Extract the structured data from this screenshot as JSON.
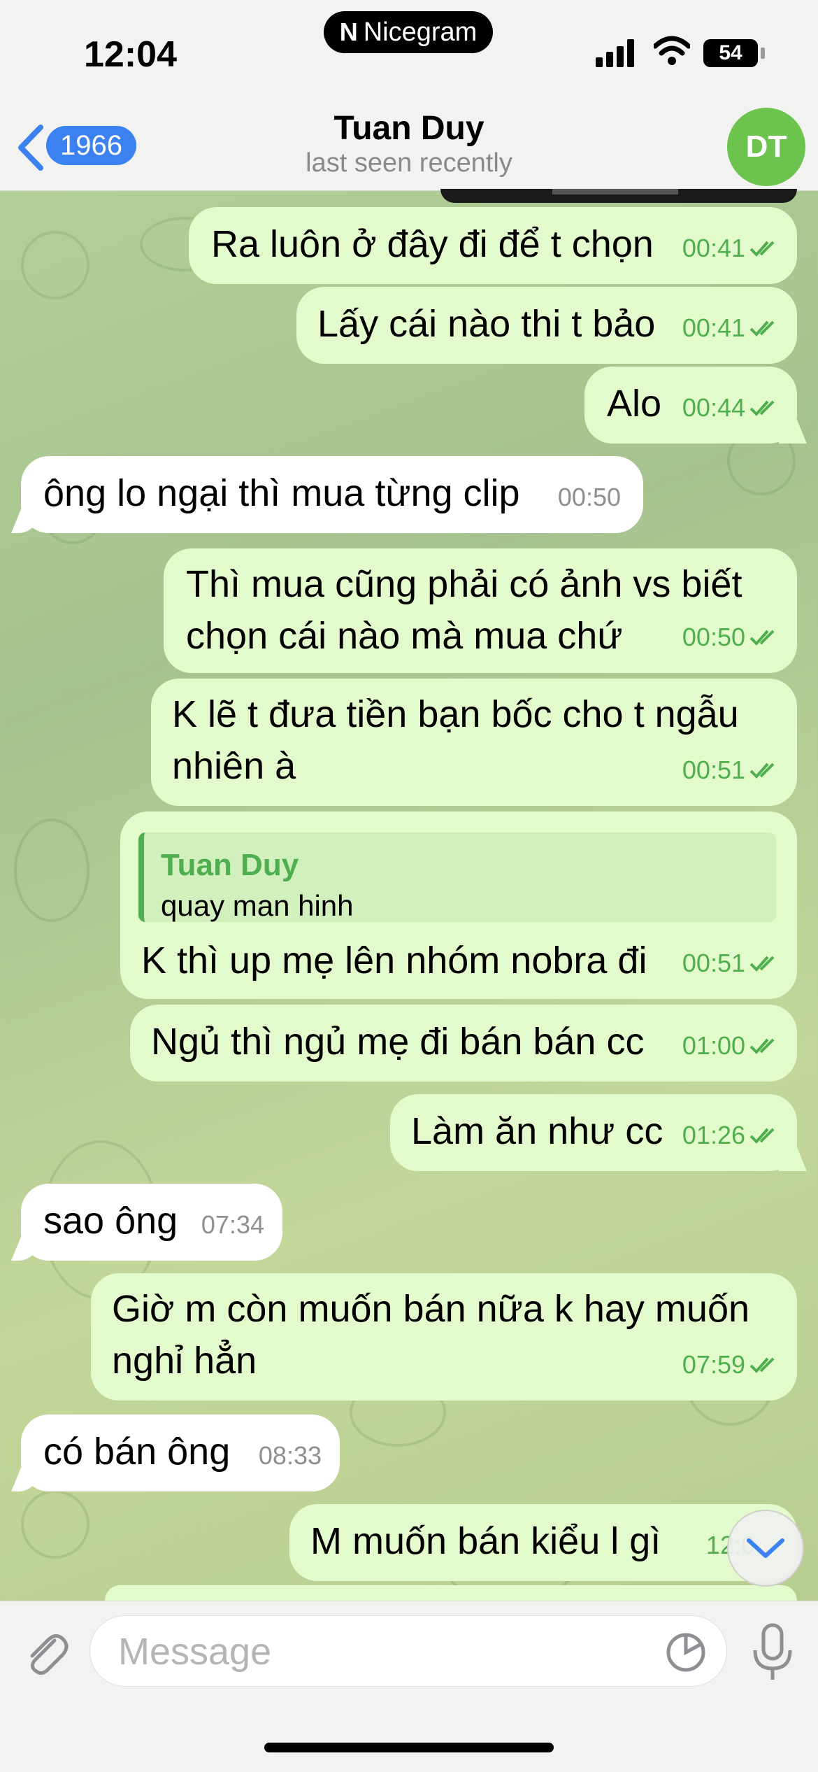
{
  "status_bar": {
    "time": "12:04",
    "app_badge": "Nicegram",
    "battery": "54"
  },
  "header": {
    "back_count": "1966",
    "title": "Tuan Duy",
    "subtitle": "last seen recently",
    "avatar_initials": "DT"
  },
  "messages": [
    {
      "dir": "out",
      "text": "Ra luôn ở đây đi để t chọn",
      "time": "00:41"
    },
    {
      "dir": "out",
      "text": "Lấy cái nào thi t bảo",
      "time": "00:41"
    },
    {
      "dir": "out",
      "text": "Alo",
      "time": "00:44"
    },
    {
      "dir": "in",
      "text": "ông lo ngại thì mua từng clip",
      "time": "00:50"
    },
    {
      "dir": "out",
      "text": "Thì mua cũng phải có ảnh vs biết\nchọn cái nào mà mua chứ",
      "time": "00:50"
    },
    {
      "dir": "out",
      "text": "K lẽ t đưa tiền bạn bốc cho t ngẫu\nnhiên à",
      "time": "00:51"
    },
    {
      "dir": "out",
      "reply_name": "Tuan Duy",
      "reply_text": "quay man hinh",
      "text": "K thì up mẹ lên nhóm nobra đi",
      "time": "00:51"
    },
    {
      "dir": "out",
      "text": "Ngủ thì ngủ mẹ đi bán bán cc",
      "time": "01:00"
    },
    {
      "dir": "out",
      "text": "Làm ăn như cc",
      "time": "01:26"
    },
    {
      "dir": "in",
      "text": "sao ông",
      "time": "07:34"
    },
    {
      "dir": "out",
      "text": "Giờ m còn muốn bán nữa k hay muốn\nnghỉ hẳn",
      "time": "07:59"
    },
    {
      "dir": "in",
      "text": "có bán ông",
      "time": "08:33"
    },
    {
      "dir": "out",
      "text": "M muốn bán kiểu l gì",
      "time": "12:0"
    }
  ],
  "composer": {
    "placeholder": "Message"
  },
  "icons": {
    "back": "chevron-left-icon",
    "attach": "paperclip-icon",
    "sticker": "sticker-icon",
    "mic": "microphone-icon",
    "scroll_down": "chevron-down-icon",
    "read": "double-check-icon"
  },
  "colors": {
    "accent": "#3b82f0",
    "outgoing_bubble": "#e3fbcc",
    "incoming_bubble": "#ffffff",
    "read_check": "#4fae4e",
    "avatar": "#6cc44f"
  }
}
